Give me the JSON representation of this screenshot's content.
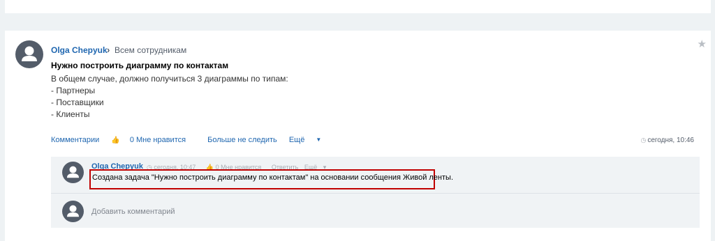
{
  "post": {
    "author": "Olga Chepyuk",
    "destination": "Всем сотрудникам",
    "title": "Нужно построить диаграмму по контактам",
    "body": [
      "В общем случае, должно получиться 3 диаграммы по типам:",
      "- Партнеры",
      "- Поставщики",
      "- Клиенты"
    ],
    "actions": {
      "comments": "Комментарии",
      "likes": "0 Мне нравится",
      "unfollow": "Больше не следить",
      "more": "Ещё"
    },
    "time": "сегодня, 10:46"
  },
  "comment": {
    "author": "Olga Chepyuk",
    "time": "сегодня, 10:47",
    "likes": "0 Мне нравится",
    "reply": "Ответить",
    "more": "Ещё",
    "text": "Создана задача \"Нужно построить диаграмму по контактам\" на основании сообщения Живой ленты."
  },
  "add_comment": {
    "placeholder": "Добавить комментарий"
  },
  "colors": {
    "link": "#2067b0",
    "avatar": "#535c69",
    "highlight": "#c00000",
    "background": "#eef2f4"
  }
}
